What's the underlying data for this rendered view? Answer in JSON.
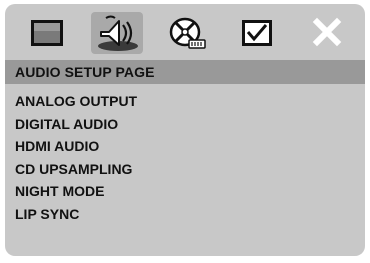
{
  "toolbar": {
    "tabs": [
      {
        "icon": "monitor-icon"
      },
      {
        "icon": "speaker-icon",
        "selected": true
      },
      {
        "icon": "disc-icon"
      },
      {
        "icon": "checkbox-icon"
      },
      {
        "icon": "close-icon"
      }
    ]
  },
  "page": {
    "title": "AUDIO SETUP PAGE"
  },
  "menu": {
    "items": [
      {
        "label": "ANALOG OUTPUT"
      },
      {
        "label": "DIGITAL AUDIO"
      },
      {
        "label": "HDMI AUDIO"
      },
      {
        "label": "CD UPSAMPLING"
      },
      {
        "label": "NIGHT MODE"
      },
      {
        "label": "LIP SYNC"
      }
    ]
  },
  "colors": {
    "panel_bg": "#c8c8c8",
    "title_bar": "#999999",
    "text": "#111111",
    "icon_dark": "#111111",
    "icon_light": "#ffffff"
  }
}
